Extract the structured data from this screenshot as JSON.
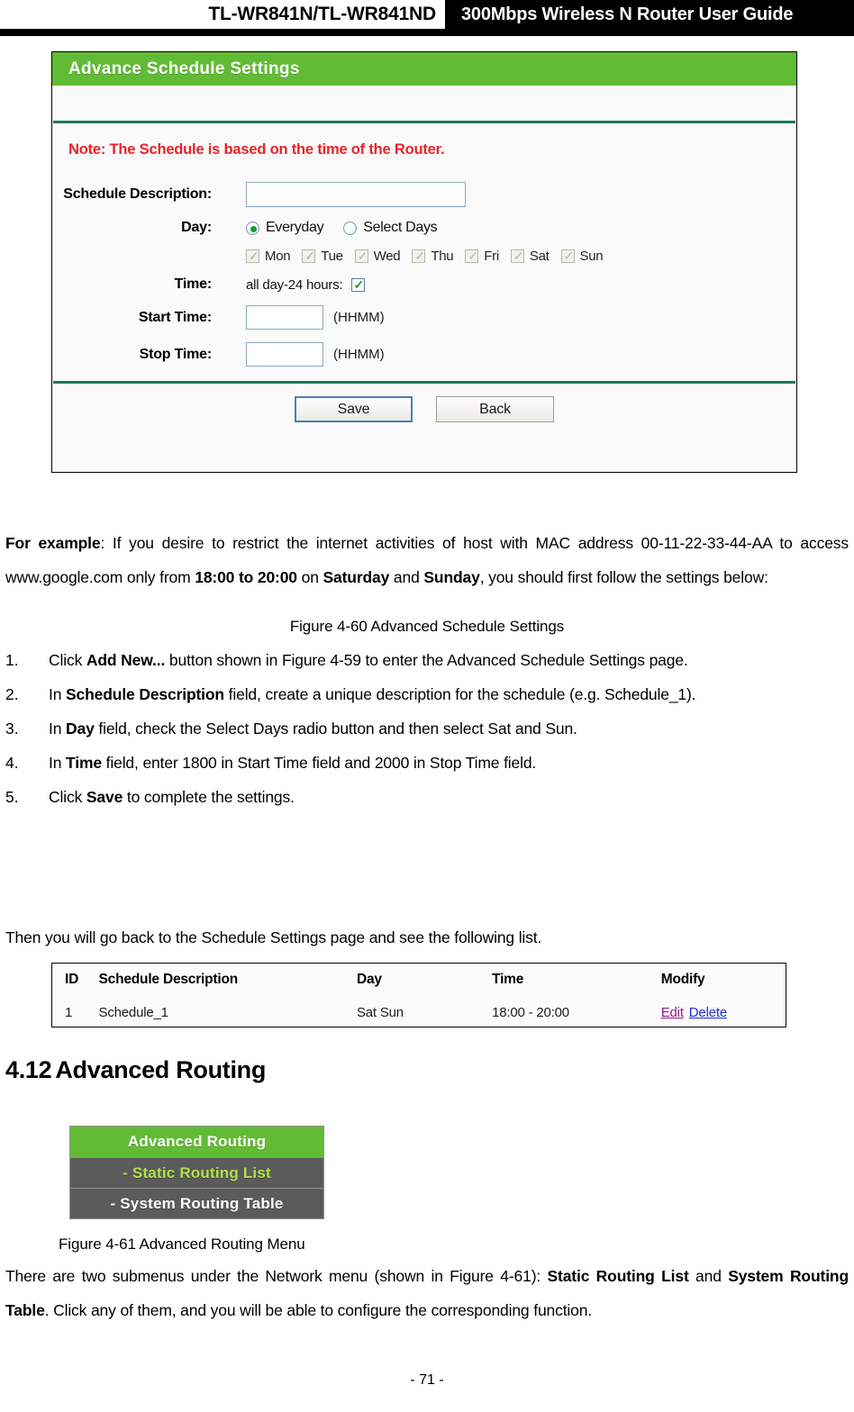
{
  "header": {
    "model": "TL-WR841N/TL-WR841ND",
    "guide_title": "300Mbps Wireless N Router User Guide"
  },
  "schedule_panel": {
    "title": "Advance Schedule Settings",
    "note": "Note: The Schedule is based on the time of the Router.",
    "note_color": "#e8232a",
    "accent_color": "#62bb35",
    "fields": {
      "description_label": "Schedule Description:",
      "description_value": "",
      "day_label": "Day:",
      "radio_everyday": "Everyday",
      "radio_select_days": "Select Days",
      "radio_selected": "Everyday",
      "days": [
        {
          "label": "Mon",
          "checked": true,
          "enabled": false
        },
        {
          "label": "Tue",
          "checked": true,
          "enabled": false
        },
        {
          "label": "Wed",
          "checked": true,
          "enabled": false
        },
        {
          "label": "Thu",
          "checked": true,
          "enabled": false
        },
        {
          "label": "Fri",
          "checked": true,
          "enabled": false
        },
        {
          "label": "Sat",
          "checked": true,
          "enabled": false
        },
        {
          "label": "Sun",
          "checked": true,
          "enabled": false
        }
      ],
      "time_label": "Time:",
      "allday_label": "all day-24 hours:",
      "allday_checked": true,
      "start_label": "Start Time:",
      "start_value": "",
      "start_hint": "(HHMM)",
      "stop_label": "Stop Time:",
      "stop_value": "",
      "stop_hint": "(HHMM)"
    },
    "buttons": {
      "save": "Save",
      "back": "Back"
    }
  },
  "captions": {
    "fig_4_60": "Figure 4-60    Advanced Schedule Settings",
    "fig_4_61": "Figure 4-61 Advanced Routing Menu"
  },
  "body": {
    "example_p1_bold": "For example",
    "example_p1_rest": ": If you desire to restrict the internet activities of host with MAC address 00-11-22-33-44-AA to access www.google.com only from ",
    "example_time_bold": "18:00 to 20:00",
    "example_mid": " on ",
    "example_sat_bold": "Saturday",
    "example_and": " and ",
    "example_sun_bold": "Sunday",
    "example_tail": ", you should first follow the settings below:",
    "steps": [
      {
        "num": "1.",
        "pre": "Click ",
        "bold": "Add New...",
        "post": " button shown in Figure 4-59 to enter the Advanced Schedule Settings page."
      },
      {
        "num": "2.",
        "pre": "In ",
        "bold": "Schedule Description",
        "post": " field, create a unique description for the schedule (e.g. Schedule_1)."
      },
      {
        "num": "3.",
        "pre": "In ",
        "bold": "Day",
        "post": " field, check the Select Days radio button and then select Sat and Sun."
      },
      {
        "num": "4.",
        "pre": "In ",
        "bold": "Time",
        "post": " field, enter 1800 in Start Time field and 2000 in Stop Time field."
      },
      {
        "num": "5.",
        "pre": "Click ",
        "bold": "Save",
        "post": " to complete the settings."
      }
    ],
    "then_text": "Then you will go back to the Schedule Settings page and see the following list.",
    "submenus_pre": "There are two submenus under the Network menu (shown in Figure 4-61): ",
    "submenus_b1": "Static Routing List",
    "submenus_mid": " and ",
    "submenus_b2": "System Routing Table",
    "submenus_post": ". Click any of them, and you will be able to configure the corresponding function."
  },
  "schedule_table": {
    "headers": [
      "ID",
      "Schedule Description",
      "Day",
      "Time",
      "Modify"
    ],
    "rows": [
      {
        "id": "1",
        "description": "Schedule_1",
        "day": "Sat  Sun",
        "time": "18:00 - 20:00",
        "edit": "Edit",
        "delete": "Delete"
      }
    ],
    "edit_color": "#8c1f8c",
    "delete_color": "#1c2ddb"
  },
  "section": {
    "number": "4.12",
    "title": "Advanced Routing"
  },
  "routing_menu": {
    "header": "Advanced Routing",
    "items": [
      {
        "label": "- Static Routing List",
        "highlighted": true
      },
      {
        "label": "- System Routing Table",
        "highlighted": false
      }
    ],
    "header_color": "#62bb35",
    "item_bg": "#5b5b5b",
    "highlight_color": "#b4e04a"
  },
  "footer": {
    "page_number": "- 71 -"
  }
}
